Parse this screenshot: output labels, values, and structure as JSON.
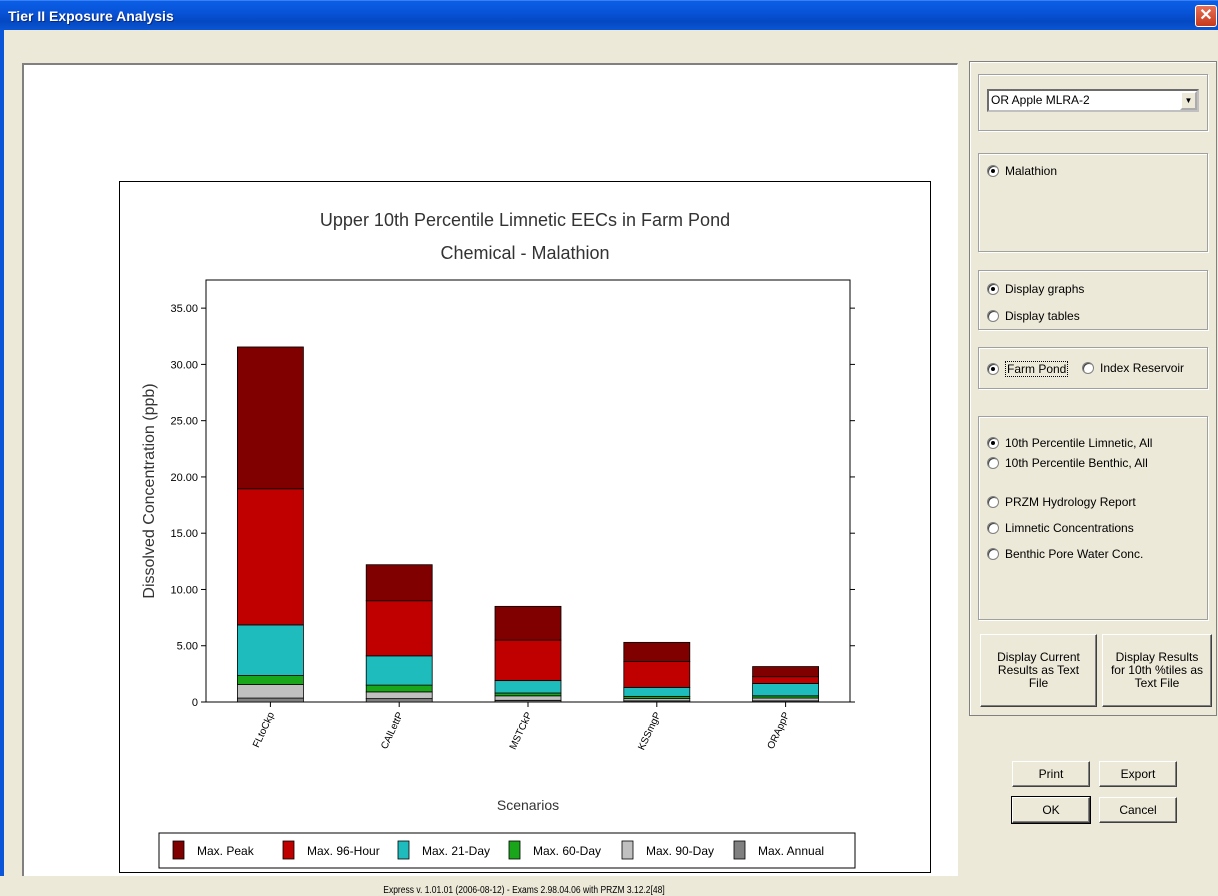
{
  "window": {
    "title": "Tier II Exposure Analysis",
    "close_label": "✕"
  },
  "scenario_select": {
    "value": "OR Apple  MLRA-2"
  },
  "chemicals": [
    {
      "label": "Malathion",
      "selected": true
    }
  ],
  "display_mode": [
    {
      "label": "Display graphs",
      "selected": true
    },
    {
      "label": "Display tables",
      "selected": false
    }
  ],
  "water_body": [
    {
      "label": "Farm Pond",
      "selected": true
    },
    {
      "label": "Index Reservoir",
      "selected": false
    }
  ],
  "report_type": [
    {
      "label": "10th Percentile Limnetic, All",
      "selected": true
    },
    {
      "label": "10th Percentile Benthic, All",
      "selected": false
    },
    {
      "label": "PRZM Hydrology Report",
      "selected": false
    },
    {
      "label": "Limnetic Concentrations",
      "selected": false
    },
    {
      "label": "Benthic Pore Water Conc.",
      "selected": false
    }
  ],
  "buttons": {
    "display_current": "Display Current Results as Text File",
    "display_10th": "Display Results for 10th %tiles as Text File",
    "print": "Print",
    "export": "Export",
    "ok": "OK",
    "cancel": "Cancel"
  },
  "footer": "Express   v. 1.01.01   (2006-08-12) - Exams 2.98.04.06 with PRZM 3.12.2[48]",
  "chart_data": {
    "type": "bar",
    "stacked": true,
    "title": "Upper 10th Percentile Limnetic EECs in Farm Pond",
    "subtitle": "Chemical - Malathion",
    "xlabel": "Scenarios",
    "ylabel": "Dissolved Concentration (ppb)",
    "ylim": [
      0,
      37.5
    ],
    "yticks": [
      "0",
      "5.00",
      "10.00",
      "15.00",
      "20.00",
      "25.00",
      "30.00",
      "35.00"
    ],
    "grid": false,
    "legend_position": "bottom",
    "categories": [
      "FLtoCkp",
      "CAlLettP",
      "MSTCkP",
      "KSSmgP",
      "ORAppP"
    ],
    "series": [
      {
        "name": "Max. Annual",
        "color": "#808080",
        "values": [
          0.35,
          0.3,
          0.15,
          0.1,
          0.1
        ]
      },
      {
        "name": "Max. 90-Day",
        "color": "#c0c0c0",
        "values": [
          1.2,
          0.6,
          0.4,
          0.2,
          0.25
        ]
      },
      {
        "name": "Max. 60-Day",
        "color": "#1aa61a",
        "values": [
          0.8,
          0.6,
          0.25,
          0.2,
          0.2
        ]
      },
      {
        "name": "Max. 21-Day",
        "color": "#1ebcbc",
        "values": [
          4.5,
          2.6,
          1.1,
          0.8,
          1.1
        ]
      },
      {
        "name": "Max. 96-Hour",
        "color": "#c00000",
        "values": [
          12.1,
          4.9,
          3.6,
          2.3,
          0.6
        ]
      },
      {
        "name": "Max. Peak",
        "color": "#800000",
        "values": [
          12.6,
          3.2,
          3.0,
          1.7,
          0.9
        ]
      }
    ],
    "legend_order": [
      "Max. Peak",
      "Max. 96-Hour",
      "Max. 21-Day",
      "Max. 60-Day",
      "Max. 90-Day",
      "Max. Annual"
    ]
  }
}
